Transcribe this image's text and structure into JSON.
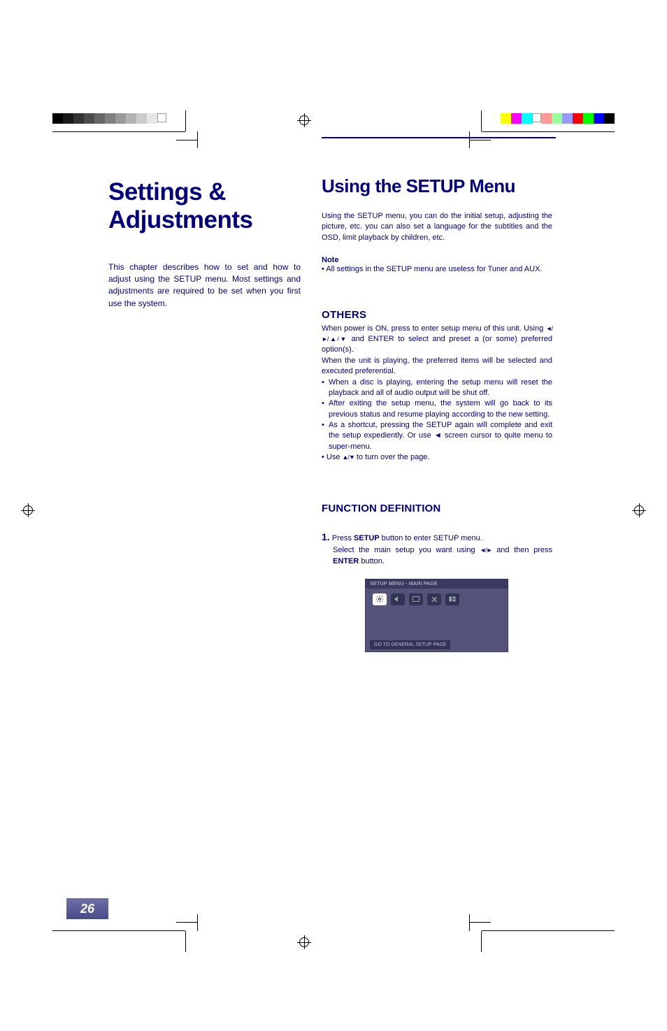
{
  "page_number": "26",
  "left": {
    "chapter_title_l1": "Settings &",
    "chapter_title_l2": "Adjustments",
    "intro": "This chapter describes how to set and how to adjust using the SETUP menu. Most settings and adjustments are required to be set when you first use the system."
  },
  "right": {
    "section_heading": "Using the SETUP Menu",
    "section_body": "Using the SETUP menu, you can do the initial setup, adjusting the picture, etc. you can also set a language for the subtitles and the OSD, limit playback by children, etc.",
    "note_label": "Note",
    "note_body": "• All settings in the SETUP menu are useless for Tuner and AUX.",
    "others_head": "OTHERS",
    "others_p1a": "When power is ON, press to enter setup menu of this unit. Using ",
    "others_p1_arrows": "◄/►/▲/▼",
    "others_p1b": " and ENTER to select and preset a (or some) preferred option(s).",
    "others_p2": "When the unit is playing, the preferred items will be selected and executed preferential.",
    "bullets": [
      "When a disc is playing, entering the setup menu will reset the playback and all of audio output will be shut off.",
      "After exiting the setup menu, the system will go back to its previous status and resume playing according to the new setting.",
      "As a shortcut, pressing the SETUP again will complete and exit the setup expediently. Or use ◄ screen cursor to quite menu to super-menu."
    ],
    "use_line_a": "• Use ",
    "use_line_arrows": "▲/▼",
    "use_line_b": " to turn over the page.",
    "fn_head": "FUNCTION DEFINITION",
    "step1_num": "1.",
    "step1_a": " Press ",
    "step1_setup": "SETUP",
    "step1_b": " button to enter SETUP menu.",
    "step1_c1": "Select the main setup you want using ",
    "step1_c_arrows": "◄/►",
    "step1_c2": " and then press ",
    "step1_enter": "ENTER",
    "step1_c3": " button."
  },
  "osd": {
    "title": "SETUP MENU - MAIN PAGE",
    "footer": "GO TO GENERAL SETUP PAGE",
    "icons": [
      {
        "name": "general-setup-icon",
        "active": true,
        "glyph": "svg-gear"
      },
      {
        "name": "speaker-setup-icon",
        "active": false,
        "glyph": "sound"
      },
      {
        "name": "dolby-setup-icon",
        "active": false,
        "glyph": "display"
      },
      {
        "name": "video-setup-icon",
        "active": false,
        "glyph": "x"
      },
      {
        "name": "preference-icon",
        "active": false,
        "glyph": "pref"
      }
    ]
  }
}
